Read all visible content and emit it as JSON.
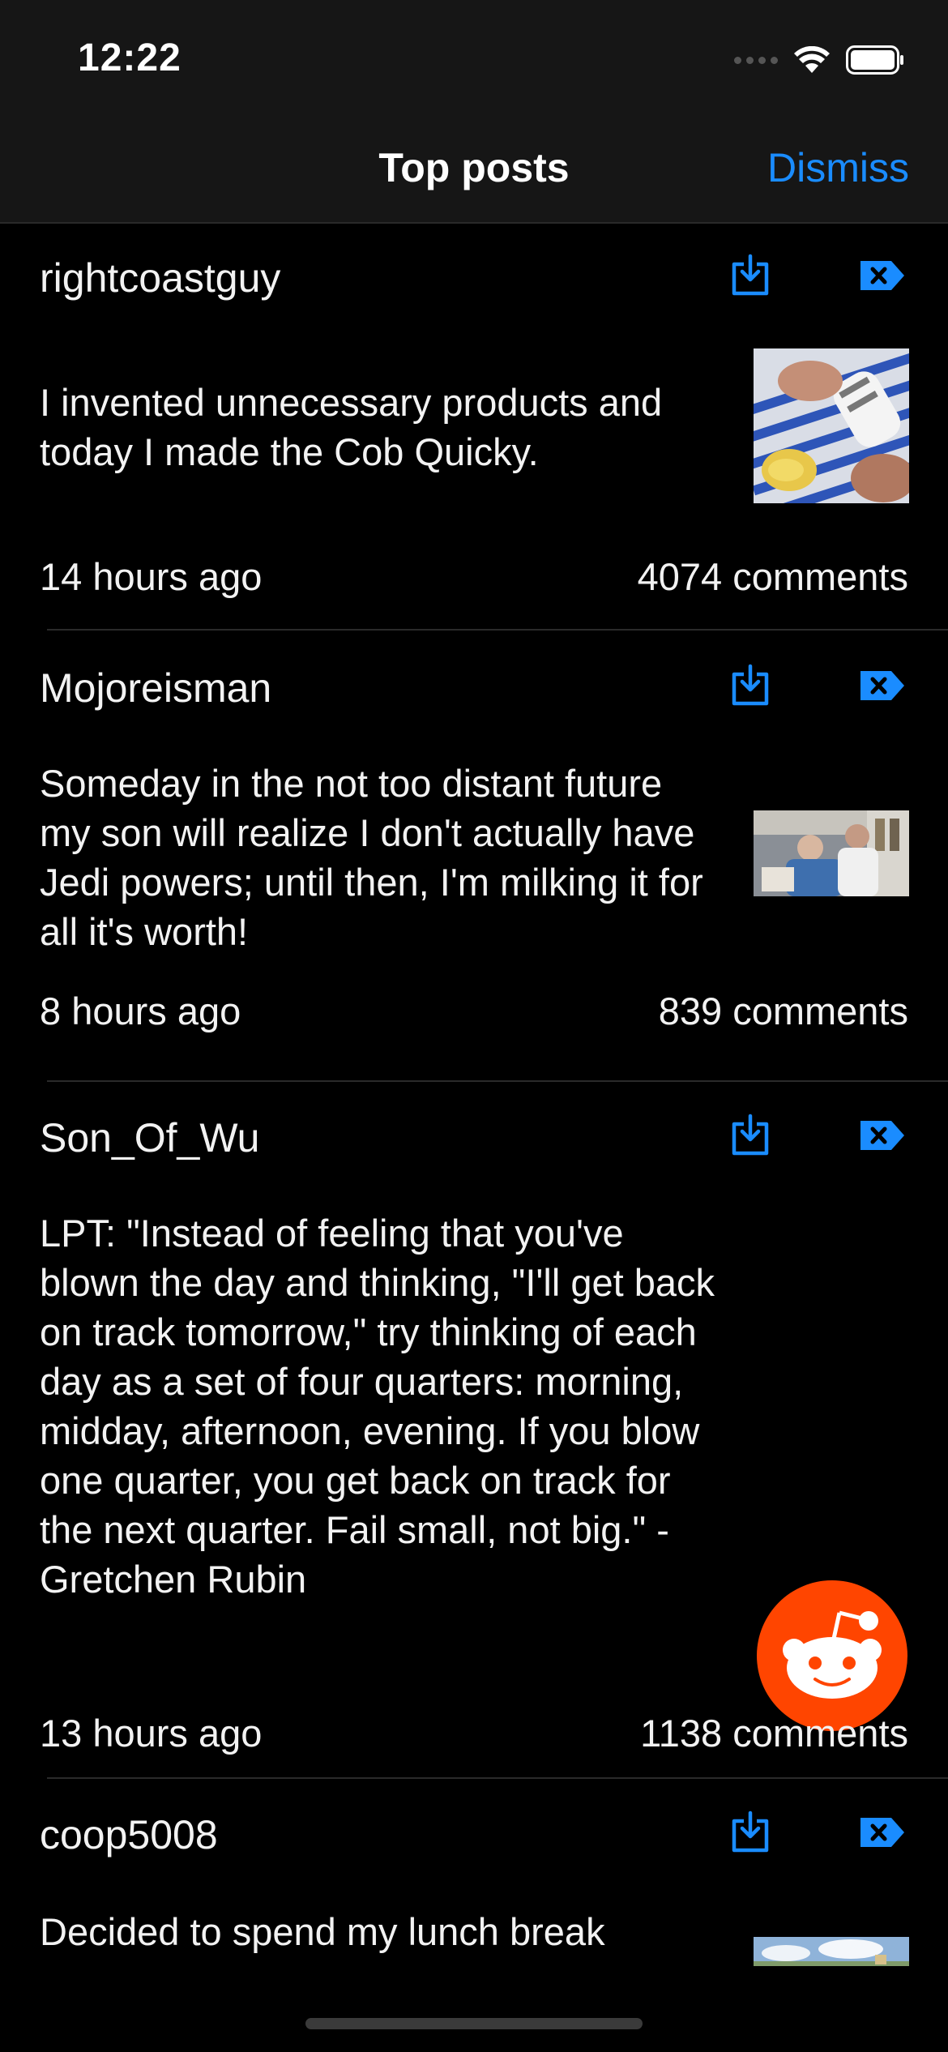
{
  "status_bar": {
    "time": "12:22"
  },
  "nav": {
    "title": "Top posts",
    "dismiss_label": "Dismiss"
  },
  "posts": [
    {
      "author": "rightcoastguy",
      "body": "I invented unnecessary products and today I made the Cob Quicky.",
      "time": "14 hours ago",
      "comments": "4074 comments",
      "thumbnail": "photo-striped-shirt-corn"
    },
    {
      "author": "Mojoreisman",
      "body": "Someday in the not too distant future my son will realize I don't actually have Jedi powers; until then, I'm milking it for all it's worth!",
      "time": "8 hours ago",
      "comments": "839 comments",
      "thumbnail": "photo-father-and-son"
    },
    {
      "author": "Son_Of_Wu",
      "body": "LPT: \"Instead of feeling that you've blown the day and thinking, \"I'll get back on track tomorrow,\" try thinking of each day as a set of four quarters: morning, midday, afternoon, evening. If you blow one quarter, you get back on track for the next quarter. Fail small, not big.\" - Gretchen Rubin",
      "time": "13 hours ago",
      "comments": "1138 comments",
      "thumbnail": "reddit-logo-icon"
    },
    {
      "author": "coop5008",
      "body": "Decided to spend my lunch break",
      "time": "",
      "comments": "",
      "thumbnail": "photo-sky-landscape"
    }
  ],
  "icons": {
    "download": "download-icon",
    "dismiss_post": "dismiss-post-icon"
  },
  "colors": {
    "accent": "#1a8cff",
    "background": "#000000",
    "bar": "#161616",
    "reddit_orange": "#ff4500"
  }
}
